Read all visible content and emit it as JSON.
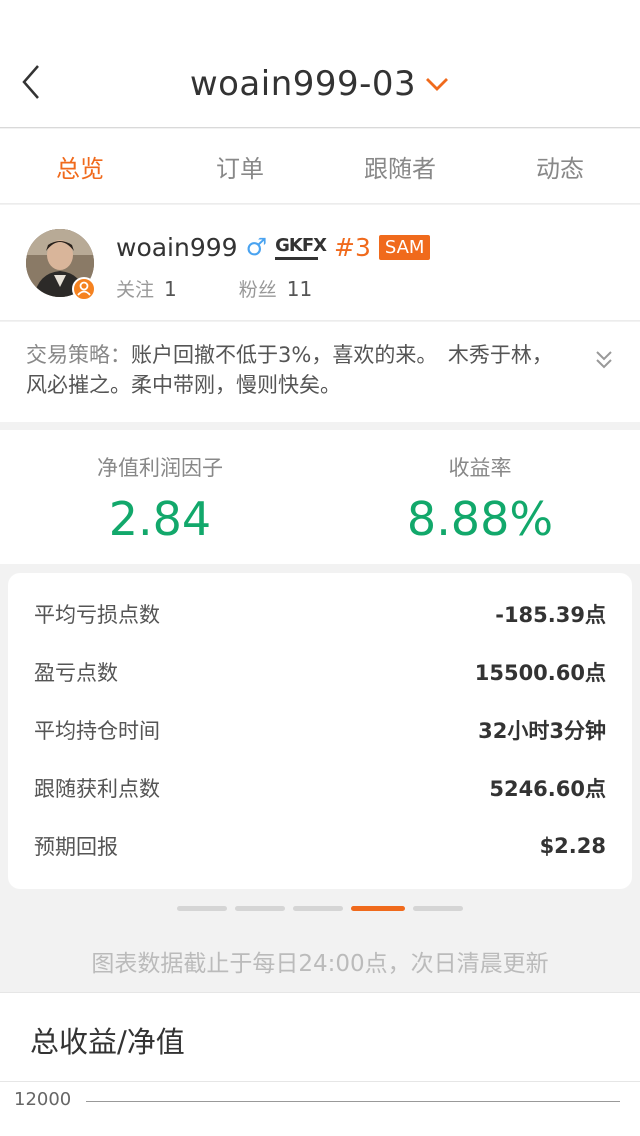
{
  "header": {
    "title": "woain999-03"
  },
  "tabs": [
    {
      "label": "总览",
      "active": true
    },
    {
      "label": "订单",
      "active": false
    },
    {
      "label": "跟随者",
      "active": false
    },
    {
      "label": "动态",
      "active": false
    }
  ],
  "profile": {
    "name": "woain999",
    "gender_symbol": "♂",
    "broker": "GKFX",
    "rank": "#3",
    "tag": "SAM",
    "following_label": "关注",
    "following_count": "1",
    "fans_label": "粉丝",
    "fans_count": "11"
  },
  "strategy": {
    "label": "交易策略：",
    "text": "账户回撤不低于3%，喜欢的来。　木秀于林，风必摧之。柔中带刚，慢则快矣。"
  },
  "stats": [
    {
      "label": "净值利润因子",
      "value": "2.84"
    },
    {
      "label": "收益率",
      "value": "8.88%"
    }
  ],
  "metrics": [
    {
      "label": "平均亏损点数",
      "value": "-185.39点"
    },
    {
      "label": "盈亏点数",
      "value": "15500.60点"
    },
    {
      "label": "平均持仓时间",
      "value": "32小时3分钟"
    },
    {
      "label": "跟随获利点数",
      "value": "5246.60点"
    },
    {
      "label": "预期回报",
      "value": "$2.28"
    }
  ],
  "pager": {
    "count": 5,
    "active_index": 3
  },
  "note": "图表数据截止于每日24:00点，次日清晨更新",
  "chart": {
    "title": "总收益/净值",
    "y_tick_top": "12000"
  },
  "colors": {
    "accent": "#f06a1c",
    "positive": "#12a86b",
    "male_blue": "#4aa3f0"
  }
}
